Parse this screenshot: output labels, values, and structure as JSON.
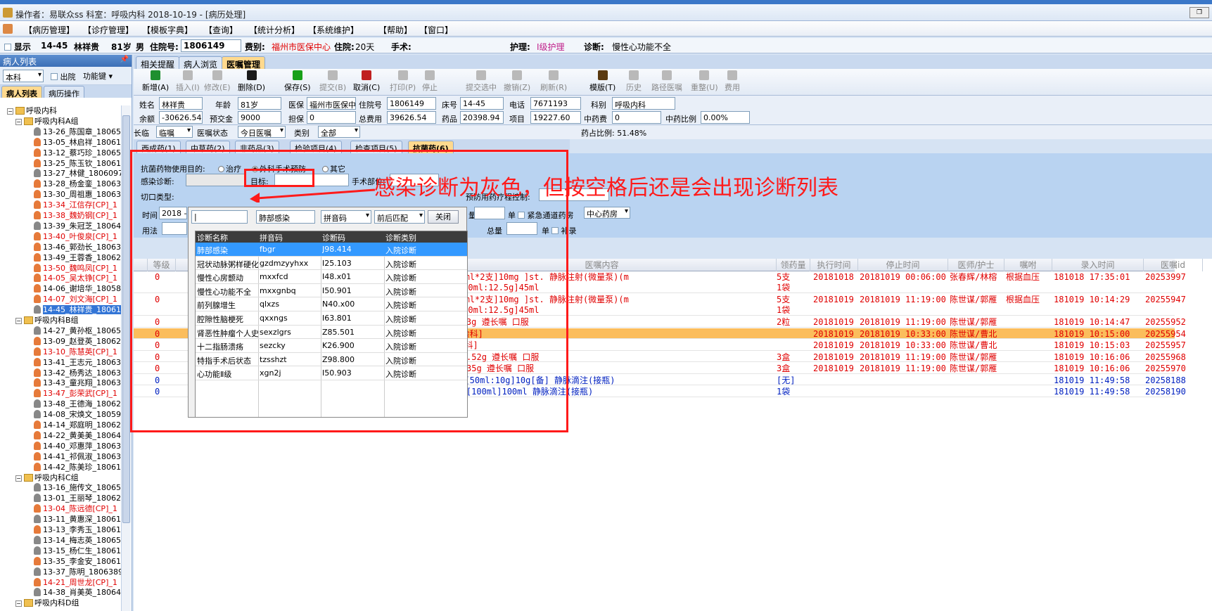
{
  "window": {
    "title": "操作者：易联众ss  科室：呼吸内科  2018-10-19 - [病历处理]"
  },
  "menu": [
    "【病历管理】",
    "【诊疗管理】",
    "【模板字典】",
    "【查询】",
    "【统计分析】",
    "【系统维护】",
    "【帮助】",
    "【窗口】"
  ],
  "patient_bar": {
    "show_label": "显示",
    "bed": "14-45",
    "name": "林祥贵",
    "age": "81岁",
    "sex": "男",
    "admission_label": "住院号:",
    "admission_no": "1806149",
    "fee_label": "费别:",
    "fee_type": "福州市医保中心",
    "stay_label": "住院:",
    "stay_days": "20天",
    "surgery_label": "手术:",
    "nursing_label": "护理:",
    "nursing_level": "Ⅰ级护理",
    "diagnosis_label": "诊断:",
    "diagnosis": "慢性心功能不全"
  },
  "left_panel": {
    "header": "病人列表",
    "dept_select": "本科",
    "discharged_label": "出院",
    "menu_label": "功能键",
    "tabs": [
      "病人列表",
      "病历操作"
    ],
    "tree": [
      {
        "level": 0,
        "type": "folder",
        "label": "呼吸内科"
      },
      {
        "level": 1,
        "type": "folder",
        "label": "呼吸内科A组"
      },
      {
        "level": 2,
        "g": "m",
        "label": "13-26_陈国章_18065",
        "c": "n"
      },
      {
        "level": 2,
        "g": "f",
        "label": "13-05_林启祥_18061",
        "c": "n"
      },
      {
        "level": 2,
        "g": "f",
        "label": "13-12_蔡巧珍_18065",
        "c": "n"
      },
      {
        "level": 2,
        "g": "f",
        "label": "13-25_陈玉钦_18061",
        "c": "n"
      },
      {
        "level": 2,
        "g": "m",
        "label": "13-27_林健_1806097",
        "c": "n"
      },
      {
        "level": 2,
        "g": "f",
        "label": "13-28_杨金銮_18063",
        "c": "n"
      },
      {
        "level": 2,
        "g": "f",
        "label": "13-30_周祖惠_18063",
        "c": "n"
      },
      {
        "level": 2,
        "g": "f",
        "label": "13-34_江信存[CP]_1",
        "c": "r"
      },
      {
        "level": 2,
        "g": "f",
        "label": "13-38_魏奶钢[CP]_1",
        "c": "r"
      },
      {
        "level": 2,
        "g": "m",
        "label": "13-39_朱冠芝_18064",
        "c": "n"
      },
      {
        "level": 2,
        "g": "f",
        "label": "13-40_叶俊泉[CP]_1",
        "c": "r"
      },
      {
        "level": 2,
        "g": "f",
        "label": "13-46_郭劲长_18063",
        "c": "n"
      },
      {
        "level": 2,
        "g": "f",
        "label": "13-49_王蓉香_18062",
        "c": "n"
      },
      {
        "level": 2,
        "g": "f",
        "label": "13-50_魏鸣凤[CP]_1",
        "c": "r"
      },
      {
        "level": 2,
        "g": "f",
        "label": "14-05_吴太铮[CP]_1",
        "c": "r"
      },
      {
        "level": 2,
        "g": "f",
        "label": "14-06_谢培华_18058",
        "c": "n"
      },
      {
        "level": 2,
        "g": "f",
        "label": "14-07_刘文海[CP]_1",
        "c": "r"
      },
      {
        "level": 2,
        "g": "m",
        "label": "14-45_林祥贵_18061",
        "c": "s"
      },
      {
        "level": 1,
        "type": "folder",
        "label": "呼吸内科B组"
      },
      {
        "level": 2,
        "g": "m",
        "label": "14-27_黄孙枢_18065",
        "c": "n"
      },
      {
        "level": 2,
        "g": "f",
        "label": "13-09_赵登英_18062",
        "c": "n"
      },
      {
        "level": 2,
        "g": "f",
        "label": "13-10_陈慧英[CP]_1",
        "c": "r"
      },
      {
        "level": 2,
        "g": "f",
        "label": "13-41_王志元_18063",
        "c": "n"
      },
      {
        "level": 2,
        "g": "f",
        "label": "13-42_杨秀达_18063",
        "c": "n"
      },
      {
        "level": 2,
        "g": "f",
        "label": "13-43_童兆翔_18063",
        "c": "n"
      },
      {
        "level": 2,
        "g": "f",
        "label": "13-47_彭荣武[CP]_1",
        "c": "r"
      },
      {
        "level": 2,
        "g": "m",
        "label": "13-48_王德海_18062",
        "c": "n"
      },
      {
        "level": 2,
        "g": "m",
        "label": "14-08_宋焕文_18059",
        "c": "n"
      },
      {
        "level": 2,
        "g": "f",
        "label": "14-14_郑庭明_18062",
        "c": "n"
      },
      {
        "level": 2,
        "g": "f",
        "label": "14-22_黄美美_18064",
        "c": "n"
      },
      {
        "level": 2,
        "g": "f",
        "label": "14-40_邓惠萍_18063",
        "c": "n"
      },
      {
        "level": 2,
        "g": "f",
        "label": "14-41_祁佩淑_18063",
        "c": "n"
      },
      {
        "level": 2,
        "g": "f",
        "label": "14-42_陈美珍_18061",
        "c": "n"
      },
      {
        "level": 1,
        "type": "folder",
        "label": "呼吸内科C组"
      },
      {
        "level": 2,
        "g": "m",
        "label": "13-16_施传文_18065",
        "c": "n"
      },
      {
        "level": 2,
        "g": "m",
        "label": "13-01_王丽琴_18062",
        "c": "n"
      },
      {
        "level": 2,
        "g": "f",
        "label": "13-04_陈远德[CP]_1",
        "c": "r"
      },
      {
        "level": 2,
        "g": "m",
        "label": "13-11_黄惠深_18061",
        "c": "n"
      },
      {
        "level": 2,
        "g": "f",
        "label": "13-13_李秀玉_18061",
        "c": "n"
      },
      {
        "level": 2,
        "g": "m",
        "label": "13-14_梅志英_18065",
        "c": "n"
      },
      {
        "level": 2,
        "g": "m",
        "label": "13-15_杨仁生_18061",
        "c": "n"
      },
      {
        "level": 2,
        "g": "f",
        "label": "13-35_李金安_18061",
        "c": "n"
      },
      {
        "level": 2,
        "g": "m",
        "label": "13-37_陈明_1806389",
        "c": "n"
      },
      {
        "level": 2,
        "g": "f",
        "label": "14-21_周世龙[CP]_1",
        "c": "r"
      },
      {
        "level": 2,
        "g": "m",
        "label": "14-38_肖美英_18064",
        "c": "n"
      },
      {
        "level": 1,
        "type": "folder",
        "label": "呼吸内科D组"
      }
    ]
  },
  "main_tabs": [
    "相关提醒",
    "病人浏览",
    "医嘱管理"
  ],
  "toolbar": [
    {
      "label": "新增(A)",
      "color": "#1f8f2f",
      "enabled": true
    },
    {
      "label": "插入(I)",
      "enabled": false
    },
    {
      "label": "修改(E)",
      "enabled": false
    },
    {
      "label": "删除(D)",
      "color": "#1a1a1a",
      "enabled": true
    },
    {
      "label": "保存(S)",
      "color": "#18a018",
      "enabled": true
    },
    {
      "label": "提交(B)",
      "enabled": false
    },
    {
      "label": "取消(C)",
      "color": "#c02020",
      "enabled": true
    },
    {
      "label": "打印(P)",
      "enabled": false
    },
    {
      "label": "停止",
      "enabled": false
    },
    {
      "label": "提交选中",
      "enabled": false
    },
    {
      "label": "撤销(Z)",
      "enabled": false
    },
    {
      "label": "刷新(R)",
      "enabled": false
    },
    {
      "label": "模版(T)",
      "color": "#5a3a10",
      "enabled": true
    },
    {
      "label": "历史",
      "enabled": false
    },
    {
      "label": "路径医嘱",
      "enabled": false
    },
    {
      "label": "重整(U)",
      "enabled": false
    },
    {
      "label": "费用",
      "enabled": false
    }
  ],
  "info_form": {
    "name_label": "姓名",
    "name": "林祥贵",
    "age_label": "年龄",
    "age": "81岁",
    "insurance_label": "医保",
    "insurance": "福州市医保中",
    "admission_label": "住院号",
    "admission": "1806149",
    "bed_label": "床号",
    "bed": "14-45",
    "phone_label": "电话",
    "phone": "7671193",
    "dept_label": "科别",
    "dept": "呼吸内科",
    "balance_label": "余额",
    "balance": "-30626.54",
    "prepay_label": "预交金",
    "prepay": "9000",
    "guarantee_label": "担保",
    "guarantee": "0",
    "total_label": "总费用",
    "total": "39626.54",
    "drug_label": "药品",
    "drug": "20398.94",
    "item_label": "项目",
    "item": "19227.60",
    "cmed_label": "中药费",
    "cmed": "0",
    "cmed_ratio_label": "中药比例",
    "cmed_ratio": "0.00%"
  },
  "subbar": {
    "type_label": "长临",
    "type_value": "临嘱",
    "status_label": "医嘱状态",
    "status_value": "今日医嘱",
    "category_label": "类别",
    "category_value": "全部",
    "drug_ratio": "药占比例: 51.48%"
  },
  "drug_tabs": [
    "西成药(1)",
    "中草药(2)",
    "非药品(3)",
    "检验项目(4)",
    "检查项目(5)",
    "抗菌药(6)"
  ],
  "anti_panel": {
    "purpose_label": "抗菌药物使用目的:",
    "radio_treat": "治疗",
    "radio_surgery": "外科手术预防",
    "radio_other": "其它",
    "infect_label": "感染诊断:",
    "target_label": "目标:",
    "site_label": "手术部位:",
    "incision_label": "切口类型:",
    "course_label": "预防用药疗程控制:",
    "time_label": "时间",
    "time_value": "2018 -",
    "amount_label": "量",
    "unit_label": "单",
    "urgent_label": "紧急通道药房",
    "pharmacy": "中心药房",
    "usage_label": "用法",
    "total_label": "总量",
    "unit_label2": "单",
    "supplement_label": "补录"
  },
  "popup": {
    "search_value": "|",
    "keyword": "肺部感染",
    "mode": "拼音码",
    "match": "前后匹配",
    "close_label": "关闭",
    "columns": [
      "诊断名称",
      "拼音码",
      "诊断码",
      "诊断类别"
    ],
    "rows": [
      [
        "肺部感染",
        "fbgr",
        "J98.414",
        "入院诊断"
      ],
      [
        "冠状动脉粥样硬化性",
        "gzdmzyyhxx",
        "I25.103",
        "入院诊断"
      ],
      [
        "慢性心房颤动",
        "mxxfcd",
        "I48.x01",
        "入院诊断"
      ],
      [
        "慢性心功能不全",
        "mxxgnbq",
        "I50.901",
        "入院诊断"
      ],
      [
        "前列腺增生",
        "qlxzs",
        "N40.x00",
        "入院诊断"
      ],
      [
        "腔隙性脑梗死",
        "qxxngs",
        "I63.801",
        "入院诊断"
      ],
      [
        "肾恶性肿瘤个人史",
        "sexzlgrs",
        "Z85.501",
        "入院诊断"
      ],
      [
        "十二指肠溃疡",
        "sezcky",
        "K26.900",
        "入院诊断"
      ],
      [
        "特指手术后状态",
        "tzsshzt",
        "Z98.800",
        "入院诊断"
      ],
      [
        "心功能Ⅱ级",
        "xgn2j",
        "I50.903",
        "入院诊断"
      ]
    ]
  },
  "grid": {
    "columns": [
      "等级",
      "医嘱内容",
      "领药量",
      "执行时间",
      "停止时间",
      "医师/护士",
      "嘱咐",
      "录入时间",
      "医嘱id"
    ],
    "rows": [
      {
        "level": "0",
        "content": "液[2mg: 1ml*2支]10mg   ]st. 静脉注射(微量泵)(m",
        "content2": ")(海王)[250ml:12.5g]45ml",
        "qty": "5支",
        "qty2": "1袋",
        "exec": "20181018",
        "stop": "20181019 00:06:00",
        "doctor": "张春辉/林榕",
        "note": "根据血压",
        "entry": "181018 17:35:01",
        "id": "20253997",
        "color": "red",
        "tall": true
      },
      {
        "level": "0",
        "content": "液[2mg: 1ml*2支]10mg   ]st. 静脉注射(微量泵)(m",
        "content2": ")(海王)[250ml:12.5g]45ml",
        "qty": "5支",
        "qty2": "1袋",
        "exec": "20181019",
        "stop": "20181019 11:19:00",
        "doctor": "陈世谋/郭雁",
        "note": "根据血压",
        "entry": "181019 10:14:29",
        "id": "20255947",
        "color": "red",
        "tall": true
      },
      {
        "level": "0",
        "content": "L(大蜜丸)]3g 遵长嘱 口服",
        "qty": "2粒",
        "exec": "20181019",
        "stop": "20181019 11:19:00",
        "doctor": "陈世谋/郭雁",
        "note": "",
        "entry": "181019 10:14:47",
        "id": "20255952",
        "color": "red"
      },
      {
        "level": "0",
        "content": "+药敏   [检验科]",
        "qty": "",
        "exec": "20181019",
        "stop": "20181019 10:33:00",
        "doctor": "陈世谋/曹北",
        "note": "",
        "entry": "181019 10:15:00",
        "id": "20255954",
        "color": "red",
        "highlight": true
      },
      {
        "level": "0",
        "content": "药敏   [检验科]",
        "qty": "",
        "exec": "20181019",
        "stop": "20181019 10:33:00",
        "doctor": "陈世谋/曹北",
        "note": "",
        "entry": "181019 10:15:03",
        "id": "20255957",
        "color": "red"
      },
      {
        "level": "0",
        "content": "38g*60s]1.52g 遵长嘱 口服",
        "qty": "3盒",
        "exec": "20181019",
        "stop": "20181019 11:19:00",
        "doctor": "陈世谋/郭雁",
        "note": "",
        "entry": "181019 10:16:06",
        "id": "20255968",
        "color": "red"
      },
      {
        "level": "0",
        "content": "5g*18s]1.35g 遵长嘱 口服",
        "qty": "3盒",
        "exec": "20181019",
        "stop": "20181019 11:19:00",
        "doctor": "陈世谋/郭雁",
        "note": "",
        "entry": "181019 10:16:06",
        "id": "20255970",
        "color": "red"
      },
      {
        "level": "0",
        "content": "福) 注射液[50ml:10g]10g[备] 静脉滴注(接瓶)",
        "qty": "[无]",
        "exec": "",
        "stop": "",
        "doctor": "",
        "note": "",
        "entry": "181019 11:49:58",
        "id": "20258188",
        "color": "blue"
      },
      {
        "level": "0",
        "content": "(软)(海王)[100ml]100ml 静脉滴注(接瓶)",
        "qty": "1袋",
        "exec": "",
        "stop": "",
        "doctor": "",
        "note": "",
        "entry": "181019 11:49:58",
        "id": "20258190",
        "color": "blue"
      }
    ]
  },
  "annotation": "感染诊断为灰色，但按空格后还是会出现诊断列表"
}
